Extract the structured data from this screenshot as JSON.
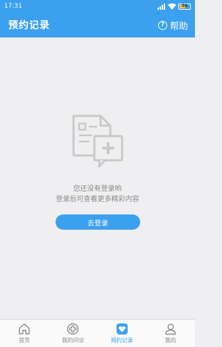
{
  "status_bar": {
    "time": "17:31",
    "battery_level": "56",
    "battery_fraction": 0.56,
    "accent_color": "#ffc043"
  },
  "header": {
    "title": "预约记录",
    "help_label": "帮助",
    "help_icon": "?",
    "background_color": "#3ba0ee"
  },
  "empty_state": {
    "icon": "document-add-icon",
    "title": "您还没有登录哟",
    "subtitle": "登录后可查看更多精彩内容",
    "login_button_label": "去登录"
  },
  "tab_bar": {
    "active_color": "#3ba0ee",
    "tabs": [
      {
        "label": "首页",
        "icon": "home-icon",
        "active": false
      },
      {
        "label": "我的问诊",
        "icon": "medical-cross-icon",
        "active": false
      },
      {
        "label": "预约记录",
        "icon": "heart-shield-icon",
        "active": true
      },
      {
        "label": "我的",
        "icon": "user-icon",
        "active": false
      }
    ]
  }
}
